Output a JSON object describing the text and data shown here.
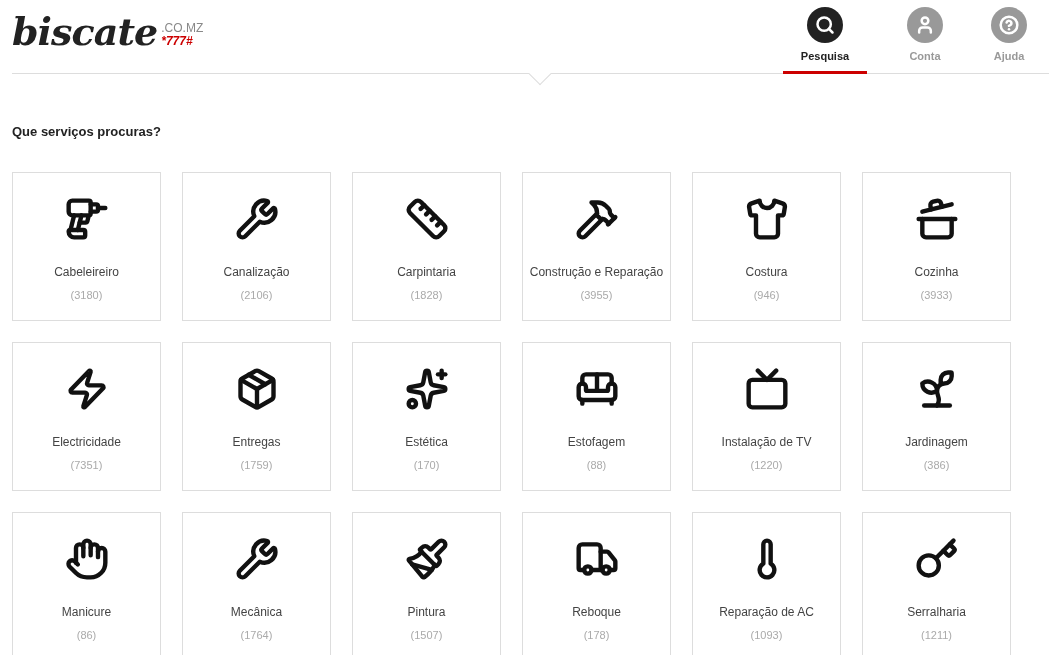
{
  "logo": {
    "name": "biscate",
    "domain": ".CO.MZ",
    "code": "*777#"
  },
  "nav": [
    {
      "label": "Pesquisa",
      "selected": true
    },
    {
      "label": "Conta",
      "selected": false
    },
    {
      "label": "Ajuda",
      "selected": false
    }
  ],
  "heading": "Que serviços procuras?",
  "categories": [
    {
      "name": "Cabeleireiro",
      "count": "(3180)"
    },
    {
      "name": "Canalização",
      "count": "(2106)"
    },
    {
      "name": "Carpintaria",
      "count": "(1828)"
    },
    {
      "name": "Construção e Reparação",
      "count": "(3955)"
    },
    {
      "name": "Costura",
      "count": "(946)"
    },
    {
      "name": "Cozinha",
      "count": "(3933)"
    },
    {
      "name": "Electricidade",
      "count": "(7351)"
    },
    {
      "name": "Entregas",
      "count": "(1759)"
    },
    {
      "name": "Estética",
      "count": "(170)"
    },
    {
      "name": "Estofagem",
      "count": "(88)"
    },
    {
      "name": "Instalação de TV",
      "count": "(1220)"
    },
    {
      "name": "Jardinagem",
      "count": "(386)"
    },
    {
      "name": "Manicure",
      "count": "(86)"
    },
    {
      "name": "Mecânica",
      "count": "(1764)"
    },
    {
      "name": "Pintura",
      "count": "(1507)"
    },
    {
      "name": "Reboque",
      "count": "(178)"
    },
    {
      "name": "Reparação de AC",
      "count": "(1093)"
    },
    {
      "name": "Serralharia",
      "count": "(1211)"
    }
  ]
}
